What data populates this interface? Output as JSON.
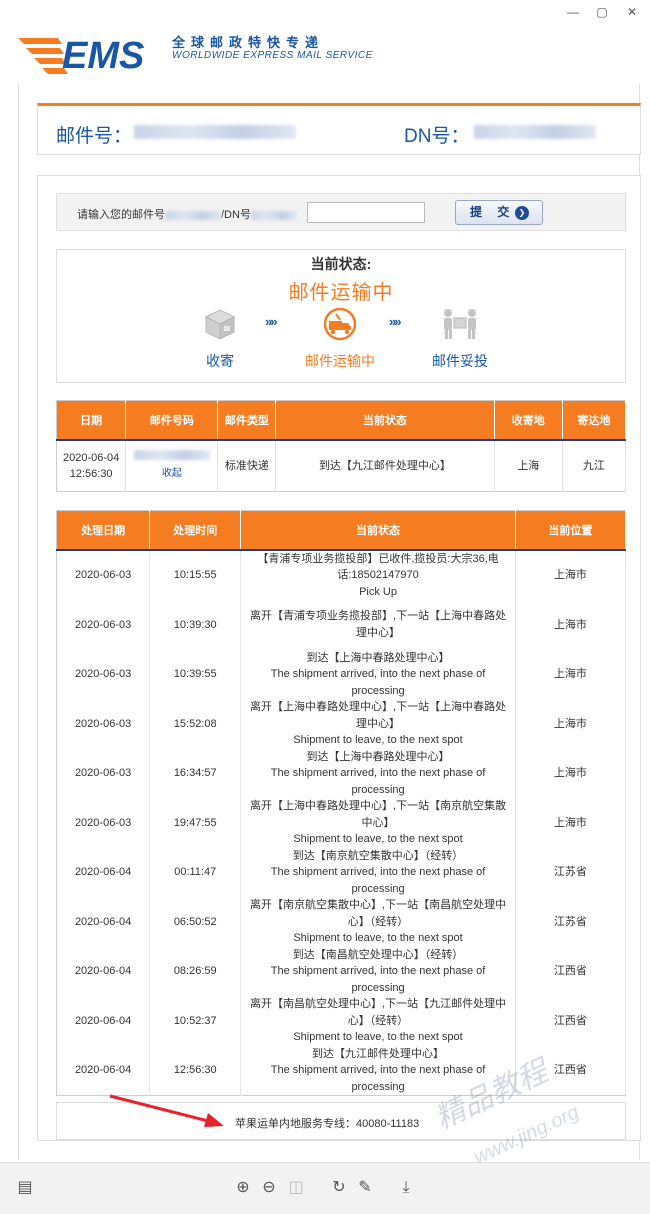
{
  "window": {
    "minimize": "—",
    "maximize": "▢",
    "close": "✕"
  },
  "brand": {
    "logo": "EMS",
    "cn": "全球邮政特快专递",
    "en": "WORLDWIDE EXPRESS MAIL SERVICE"
  },
  "numbers": {
    "mail_label": "邮件号：",
    "dn_label": "DN号："
  },
  "search": {
    "label_pre": "请输入您的邮件号",
    "label_mid": "/DN号",
    "input_value": "",
    "submit_label": "提 交"
  },
  "status": {
    "title": "当前状态:",
    "current": "邮件运输中",
    "steps": [
      {
        "label": "收寄",
        "icon": "box-icon"
      },
      {
        "label": "邮件运输中",
        "icon": "truck-icon"
      },
      {
        "label": "邮件妥投",
        "icon": "delivery-icon"
      }
    ],
    "arrow": "»»"
  },
  "summary": {
    "headers": [
      "日期",
      "邮件号码",
      "邮件类型",
      "当前状态",
      "收寄地",
      "寄达地"
    ],
    "row": {
      "date": "2020-06-04 12:56:30",
      "number_link": "收起",
      "type": "标准快递",
      "status": "到达【九江邮件处理中心】",
      "origin": "上海",
      "dest": "九江"
    }
  },
  "tracking": {
    "headers": [
      "处理日期",
      "处理时间",
      "当前状态",
      "当前位置"
    ],
    "rows": [
      {
        "date": "2020-06-03",
        "time": "10:15:55",
        "status": "【青浦专项业务揽投部】已收件,揽投员:大宗36,电话:18502147970",
        "status_en": "Pick Up",
        "loc": "上海市"
      },
      {
        "date": "2020-06-03",
        "time": "10:39:30",
        "status": "离开【青浦专项业务揽投部】,下一站【上海中春路处理中心】",
        "status_en": "",
        "loc": "上海市"
      },
      {
        "date": "2020-06-03",
        "time": "10:39:55",
        "status": "到达【上海中春路处理中心】",
        "status_en": "The shipment arrived, into the next phase of processing",
        "loc": "上海市"
      },
      {
        "date": "2020-06-03",
        "time": "15:52:08",
        "status": "离开【上海中春路处理中心】,下一站【上海中春路处理中心】",
        "status_en": "Shipment to leave, to the next spot",
        "loc": "上海市"
      },
      {
        "date": "2020-06-03",
        "time": "16:34:57",
        "status": "到达【上海中春路处理中心】",
        "status_en": "The shipment arrived, into the next phase of processing",
        "loc": "上海市"
      },
      {
        "date": "2020-06-03",
        "time": "19:47:55",
        "status": "离开【上海中春路处理中心】,下一站【南京航空集散中心】",
        "status_en": "Shipment to leave, to the next spot",
        "loc": "上海市"
      },
      {
        "date": "2020-06-04",
        "time": "00:11:47",
        "status": "到达【南京航空集散中心】（经转）",
        "status_en": "The shipment arrived, into the next phase of processing",
        "loc": "江苏省"
      },
      {
        "date": "2020-06-04",
        "time": "06:50:52",
        "status": "离开【南京航空集散中心】,下一站【南昌航空处理中心】（经转）",
        "status_en": "Shipment to leave, to the next spot",
        "loc": "江苏省"
      },
      {
        "date": "2020-06-04",
        "time": "08:26:59",
        "status": "到达【南昌航空处理中心】（经转）",
        "status_en": "The shipment arrived, into the next phase of processing",
        "loc": "江西省"
      },
      {
        "date": "2020-06-04",
        "time": "10:52:37",
        "status": "离开【南昌航空处理中心】,下一站【九江邮件处理中心】（经转）",
        "status_en": "Shipment to leave, to the next spot",
        "loc": "江西省"
      },
      {
        "date": "2020-06-04",
        "time": "12:56:30",
        "status": "到达【九江邮件处理中心】",
        "status_en": "The shipment arrived, into the next phase of processing",
        "loc": "江西省"
      }
    ]
  },
  "hotline": "苹果运单内地服务专线：40080-11183",
  "watermark": {
    "main": "精品教程",
    "sub": "www.jing.org"
  },
  "toolbar": [
    "sidebar-icon",
    "zoom-in-icon",
    "zoom-out-icon",
    "fit-page-icon",
    "rotate-icon",
    "draw-icon",
    "download-icon"
  ]
}
